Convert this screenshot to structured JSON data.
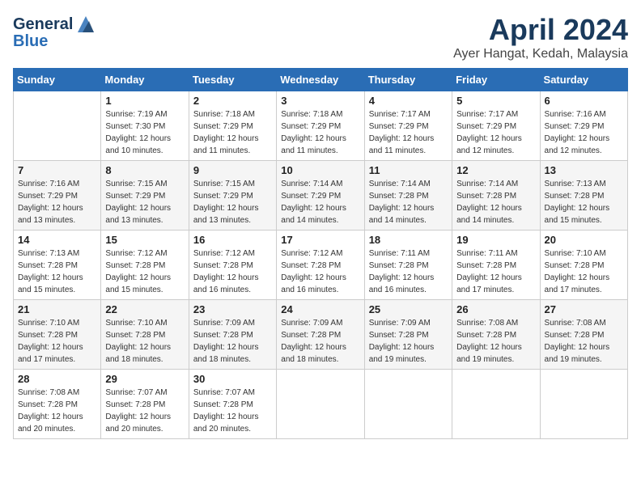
{
  "header": {
    "logo_general": "General",
    "logo_blue": "Blue",
    "month_title": "April 2024",
    "subtitle": "Ayer Hangat, Kedah, Malaysia"
  },
  "weekdays": [
    "Sunday",
    "Monday",
    "Tuesday",
    "Wednesday",
    "Thursday",
    "Friday",
    "Saturday"
  ],
  "weeks": [
    [
      {
        "day": "",
        "sunrise": "",
        "sunset": "",
        "daylight": ""
      },
      {
        "day": "1",
        "sunrise": "Sunrise: 7:19 AM",
        "sunset": "Sunset: 7:30 PM",
        "daylight": "Daylight: 12 hours and 10 minutes."
      },
      {
        "day": "2",
        "sunrise": "Sunrise: 7:18 AM",
        "sunset": "Sunset: 7:29 PM",
        "daylight": "Daylight: 12 hours and 11 minutes."
      },
      {
        "day": "3",
        "sunrise": "Sunrise: 7:18 AM",
        "sunset": "Sunset: 7:29 PM",
        "daylight": "Daylight: 12 hours and 11 minutes."
      },
      {
        "day": "4",
        "sunrise": "Sunrise: 7:17 AM",
        "sunset": "Sunset: 7:29 PM",
        "daylight": "Daylight: 12 hours and 11 minutes."
      },
      {
        "day": "5",
        "sunrise": "Sunrise: 7:17 AM",
        "sunset": "Sunset: 7:29 PM",
        "daylight": "Daylight: 12 hours and 12 minutes."
      },
      {
        "day": "6",
        "sunrise": "Sunrise: 7:16 AM",
        "sunset": "Sunset: 7:29 PM",
        "daylight": "Daylight: 12 hours and 12 minutes."
      }
    ],
    [
      {
        "day": "7",
        "sunrise": "Sunrise: 7:16 AM",
        "sunset": "Sunset: 7:29 PM",
        "daylight": "Daylight: 12 hours and 13 minutes."
      },
      {
        "day": "8",
        "sunrise": "Sunrise: 7:15 AM",
        "sunset": "Sunset: 7:29 PM",
        "daylight": "Daylight: 12 hours and 13 minutes."
      },
      {
        "day": "9",
        "sunrise": "Sunrise: 7:15 AM",
        "sunset": "Sunset: 7:29 PM",
        "daylight": "Daylight: 12 hours and 13 minutes."
      },
      {
        "day": "10",
        "sunrise": "Sunrise: 7:14 AM",
        "sunset": "Sunset: 7:29 PM",
        "daylight": "Daylight: 12 hours and 14 minutes."
      },
      {
        "day": "11",
        "sunrise": "Sunrise: 7:14 AM",
        "sunset": "Sunset: 7:28 PM",
        "daylight": "Daylight: 12 hours and 14 minutes."
      },
      {
        "day": "12",
        "sunrise": "Sunrise: 7:14 AM",
        "sunset": "Sunset: 7:28 PM",
        "daylight": "Daylight: 12 hours and 14 minutes."
      },
      {
        "day": "13",
        "sunrise": "Sunrise: 7:13 AM",
        "sunset": "Sunset: 7:28 PM",
        "daylight": "Daylight: 12 hours and 15 minutes."
      }
    ],
    [
      {
        "day": "14",
        "sunrise": "Sunrise: 7:13 AM",
        "sunset": "Sunset: 7:28 PM",
        "daylight": "Daylight: 12 hours and 15 minutes."
      },
      {
        "day": "15",
        "sunrise": "Sunrise: 7:12 AM",
        "sunset": "Sunset: 7:28 PM",
        "daylight": "Daylight: 12 hours and 15 minutes."
      },
      {
        "day": "16",
        "sunrise": "Sunrise: 7:12 AM",
        "sunset": "Sunset: 7:28 PM",
        "daylight": "Daylight: 12 hours and 16 minutes."
      },
      {
        "day": "17",
        "sunrise": "Sunrise: 7:12 AM",
        "sunset": "Sunset: 7:28 PM",
        "daylight": "Daylight: 12 hours and 16 minutes."
      },
      {
        "day": "18",
        "sunrise": "Sunrise: 7:11 AM",
        "sunset": "Sunset: 7:28 PM",
        "daylight": "Daylight: 12 hours and 16 minutes."
      },
      {
        "day": "19",
        "sunrise": "Sunrise: 7:11 AM",
        "sunset": "Sunset: 7:28 PM",
        "daylight": "Daylight: 12 hours and 17 minutes."
      },
      {
        "day": "20",
        "sunrise": "Sunrise: 7:10 AM",
        "sunset": "Sunset: 7:28 PM",
        "daylight": "Daylight: 12 hours and 17 minutes."
      }
    ],
    [
      {
        "day": "21",
        "sunrise": "Sunrise: 7:10 AM",
        "sunset": "Sunset: 7:28 PM",
        "daylight": "Daylight: 12 hours and 17 minutes."
      },
      {
        "day": "22",
        "sunrise": "Sunrise: 7:10 AM",
        "sunset": "Sunset: 7:28 PM",
        "daylight": "Daylight: 12 hours and 18 minutes."
      },
      {
        "day": "23",
        "sunrise": "Sunrise: 7:09 AM",
        "sunset": "Sunset: 7:28 PM",
        "daylight": "Daylight: 12 hours and 18 minutes."
      },
      {
        "day": "24",
        "sunrise": "Sunrise: 7:09 AM",
        "sunset": "Sunset: 7:28 PM",
        "daylight": "Daylight: 12 hours and 18 minutes."
      },
      {
        "day": "25",
        "sunrise": "Sunrise: 7:09 AM",
        "sunset": "Sunset: 7:28 PM",
        "daylight": "Daylight: 12 hours and 19 minutes."
      },
      {
        "day": "26",
        "sunrise": "Sunrise: 7:08 AM",
        "sunset": "Sunset: 7:28 PM",
        "daylight": "Daylight: 12 hours and 19 minutes."
      },
      {
        "day": "27",
        "sunrise": "Sunrise: 7:08 AM",
        "sunset": "Sunset: 7:28 PM",
        "daylight": "Daylight: 12 hours and 19 minutes."
      }
    ],
    [
      {
        "day": "28",
        "sunrise": "Sunrise: 7:08 AM",
        "sunset": "Sunset: 7:28 PM",
        "daylight": "Daylight: 12 hours and 20 minutes."
      },
      {
        "day": "29",
        "sunrise": "Sunrise: 7:07 AM",
        "sunset": "Sunset: 7:28 PM",
        "daylight": "Daylight: 12 hours and 20 minutes."
      },
      {
        "day": "30",
        "sunrise": "Sunrise: 7:07 AM",
        "sunset": "Sunset: 7:28 PM",
        "daylight": "Daylight: 12 hours and 20 minutes."
      },
      {
        "day": "",
        "sunrise": "",
        "sunset": "",
        "daylight": ""
      },
      {
        "day": "",
        "sunrise": "",
        "sunset": "",
        "daylight": ""
      },
      {
        "day": "",
        "sunrise": "",
        "sunset": "",
        "daylight": ""
      },
      {
        "day": "",
        "sunrise": "",
        "sunset": "",
        "daylight": ""
      }
    ]
  ]
}
